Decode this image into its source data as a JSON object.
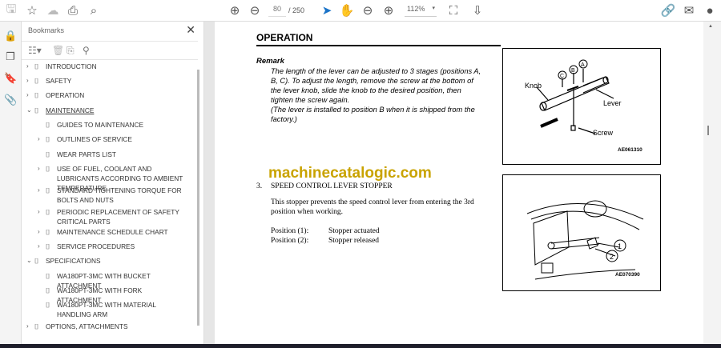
{
  "toolbar": {
    "page_current": "80",
    "page_total": "/ 250",
    "zoom": "112%"
  },
  "bookmarks": {
    "title": "Bookmarks",
    "items": [
      {
        "label": "INTRODUCTION",
        "level": 0,
        "chevron": "›"
      },
      {
        "label": "SAFETY",
        "level": 0,
        "chevron": "›"
      },
      {
        "label": "OPERATION",
        "level": 0,
        "chevron": "›"
      },
      {
        "label": "MAINTENANCE",
        "level": 0,
        "chevron": "⌄"
      },
      {
        "label": "GUIDES TO MAINTENANCE",
        "level": 1,
        "chevron": ""
      },
      {
        "label": "OUTLINES OF SERVICE",
        "level": 1,
        "chevron": "›"
      },
      {
        "label": "WEAR PARTS LIST",
        "level": 1,
        "chevron": ""
      },
      {
        "label": "USE OF FUEL, COOLANT AND LUBRICANTS ACCORDING TO AMBIENT TEMPERATURE",
        "level": 1,
        "chevron": "›"
      },
      {
        "label": "STANDARD TIGHTENING TORQUE FOR BOLTS AND NUTS",
        "level": 1,
        "chevron": "›"
      },
      {
        "label": "PERIODIC REPLACEMENT OF SAFETY CRITICAL PARTS",
        "level": 1,
        "chevron": "›"
      },
      {
        "label": "MAINTENANCE SCHEDULE CHART",
        "level": 1,
        "chevron": "›"
      },
      {
        "label": "SERVICE PROCEDURES",
        "level": 1,
        "chevron": "›"
      },
      {
        "label": "SPECIFICATIONS",
        "level": 0,
        "chevron": "⌄"
      },
      {
        "label": "WA180PT-3MC WITH BUCKET ATTACHMENT",
        "level": 1,
        "chevron": ""
      },
      {
        "label": "WA180PT-3MC WITH FORK ATTACHMENT",
        "level": 1,
        "chevron": ""
      },
      {
        "label": "WA180PT-3MC WITH MATERIAL HANDLING ARM",
        "level": 1,
        "chevron": ""
      },
      {
        "label": "OPTIONS, ATTACHMENTS",
        "level": 0,
        "chevron": "›"
      }
    ]
  },
  "doc": {
    "heading": "OPERATION",
    "remark_title": "Remark",
    "remark_lines": [
      "The length of the lever can be adjusted to 3 stages (positions A,",
      "B, C). To adjust the length, remove the screw at the bottom of",
      "the lever knob, slide the knob to the desired position, then",
      "tighten the screw again.",
      "(The lever is installed to position B when it is shipped from the",
      "factory.)"
    ],
    "watermark": "machinecatalogic.com",
    "section_num": "3.",
    "section_title": "SPEED CONTROL LEVER STOPPER",
    "section_lines": [
      "This stopper prevents the speed control lever from entering the 3rd",
      "position when working."
    ],
    "positions": [
      {
        "label": "Position (1):",
        "value": "Stopper actuated"
      },
      {
        "label": "Position (2):",
        "value": "Stopper released"
      }
    ],
    "fig1": {
      "labels": {
        "knob": "Knob",
        "lever": "Lever",
        "screw": "Screw",
        "a": "A",
        "b": "B",
        "c": "C"
      },
      "code": "AE061310"
    },
    "fig2": {
      "labels": {
        "one": "1",
        "two": "2"
      },
      "code": "AE070390"
    }
  }
}
